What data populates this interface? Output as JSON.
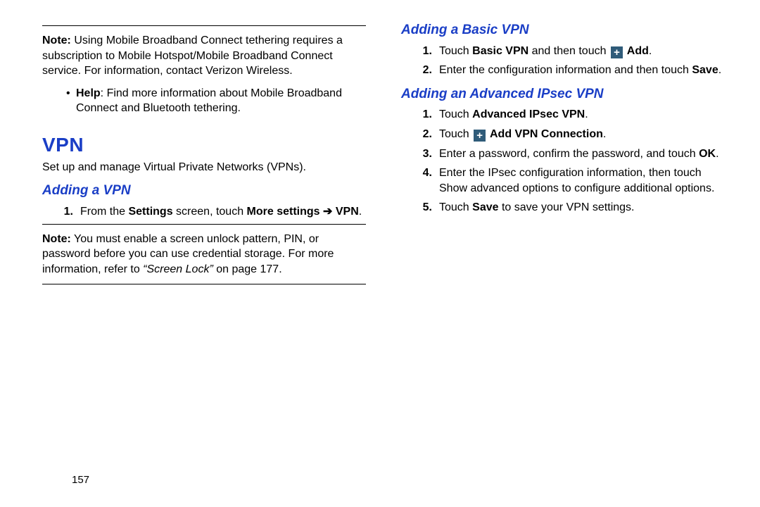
{
  "page_number": "157",
  "left": {
    "note1_label": "Note:",
    "note1_body": "Using Mobile Broadband Connect tethering requires a subscription to Mobile Hotspot/Mobile Broadband Connect service. For information, contact Verizon Wireless.",
    "help_label": "Help",
    "help_body": ": Find more information about Mobile Broadband Connect and Bluetooth tethering.",
    "h1": "VPN",
    "intro": "Set up and manage Virtual Private Networks (VPNs).",
    "h2": "Adding a VPN",
    "step1_a": "From the ",
    "step1_b": "Settings",
    "step1_c": " screen, touch ",
    "step1_d": "More settings ",
    "step1_arrow": "➔",
    "step1_e": "VPN",
    "step1_f": ".",
    "note2_label": "Note:",
    "note2_body_a": "You must enable a screen unlock pattern, PIN, or password before you can use credential storage. For more information, refer to ",
    "note2_body_b": "“Screen Lock”",
    "note2_body_c": " on page 177."
  },
  "right": {
    "h2a": "Adding a Basic VPN",
    "a1_a": "Touch ",
    "a1_b": "Basic VPN",
    "a1_c": " and then touch ",
    "a1_d": " Add",
    "a1_e": ".",
    "a2_a": "Enter the configuration information and then touch ",
    "a2_b": "Save",
    "a2_c": ".",
    "h2b": "Adding an Advanced IPsec VPN",
    "b1_a": "Touch ",
    "b1_b": "Advanced IPsec VPN",
    "b1_c": ".",
    "b2_a": "Touch ",
    "b2_b": " Add VPN Connection",
    "b2_c": ".",
    "b3_a": "Enter a password, confirm the password, and touch ",
    "b3_b": "OK",
    "b3_c": ".",
    "b4": "Enter the IPsec configuration information, then touch Show advanced options to configure additional options.",
    "b5_a": "Touch ",
    "b5_b": "Save",
    "b5_c": " to save your VPN settings.",
    "plus": "+"
  },
  "nums": {
    "n1": "1.",
    "n2": "2.",
    "n3": "3.",
    "n4": "4.",
    "n5": "5."
  }
}
